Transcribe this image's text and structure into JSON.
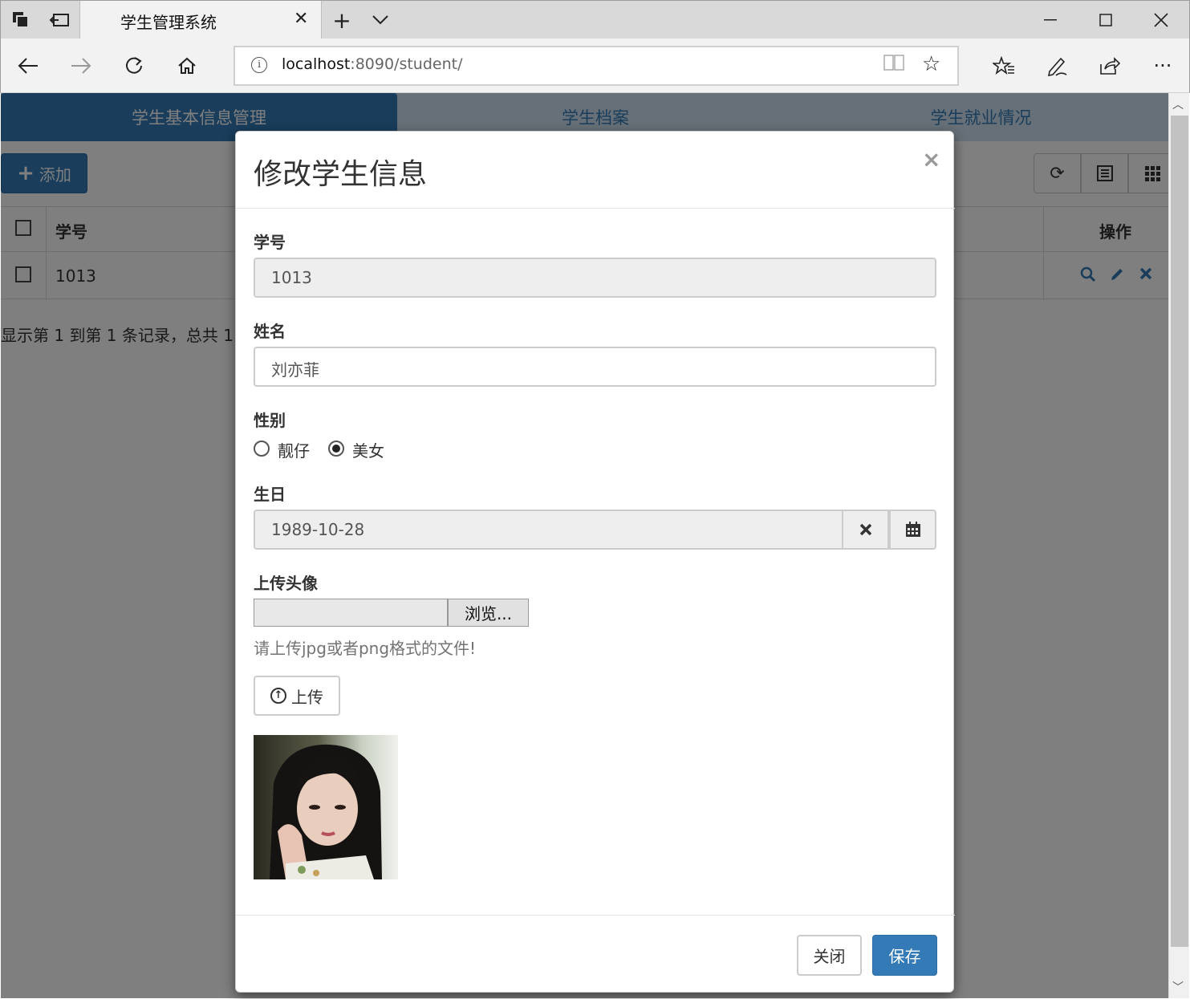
{
  "browser": {
    "tab_title": "学生管理系统",
    "address_host": "localhost",
    "address_path": ":8090/student/"
  },
  "page": {
    "tabs": [
      {
        "label": "学生基本信息管理",
        "active": true
      },
      {
        "label": "学生档案",
        "active": false
      },
      {
        "label": "学生就业情况",
        "active": false
      }
    ],
    "add_button": "添加",
    "table": {
      "headers": {
        "id": "学号",
        "actions": "操作"
      },
      "rows": [
        {
          "id": "1013"
        }
      ]
    },
    "pagination_info": "显示第 1 到第 1 条记录，总共 1"
  },
  "modal": {
    "title": "修改学生信息",
    "fields": {
      "student_id": {
        "label": "学号",
        "value": "1013"
      },
      "name": {
        "label": "姓名",
        "value": "刘亦菲"
      },
      "gender": {
        "label": "性别",
        "options": [
          "靓仔",
          "美女"
        ],
        "selected": "美女"
      },
      "birthday": {
        "label": "生日",
        "value": "1989-10-28"
      },
      "avatar": {
        "label": "上传头像",
        "browse_label": "浏览...",
        "hint": "请上传jpg或者png格式的文件!",
        "upload_label": "上传"
      }
    },
    "footer": {
      "close": "关闭",
      "save": "保存"
    }
  },
  "colors": {
    "primary": "#337ab7",
    "backdrop": "rgba(0,0,0,0.5)"
  }
}
